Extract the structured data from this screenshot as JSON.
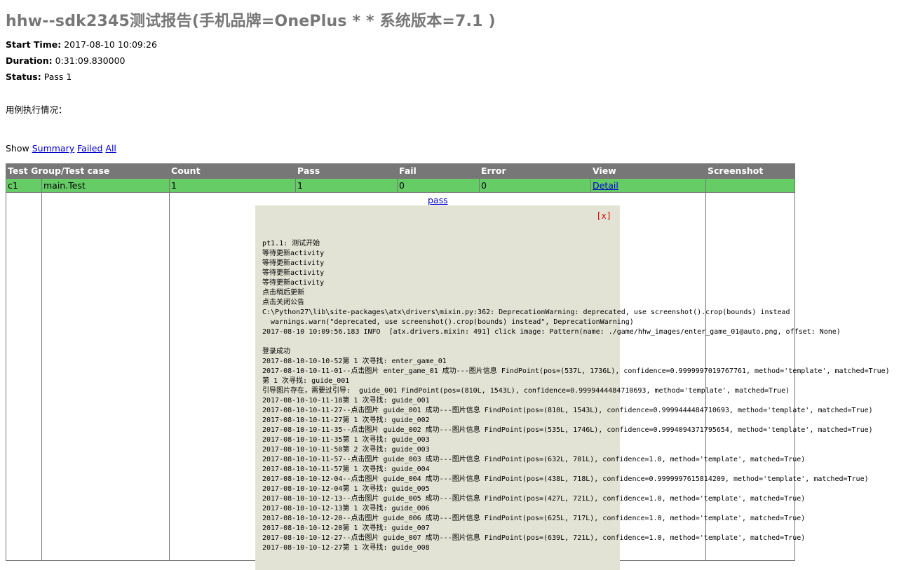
{
  "header": {
    "title": "hhw--sdk2345测试报告(手机品牌=OnePlus * * 系统版本=7.1 )",
    "start_label": "Start Time:",
    "start_value": "2017-08-10 10:09:26",
    "duration_label": "Duration:",
    "duration_value": "0:31:09.830000",
    "status_label": "Status:",
    "status_value": "Pass 1"
  },
  "usage_text": "用例执行情况：",
  "filter": {
    "show_label": "Show",
    "summary": "Summary",
    "failed": "Failed",
    "all": "All"
  },
  "table": {
    "headers": [
      "Test Group/Test case",
      "Count",
      "Pass",
      "Fail",
      "Error",
      "View",
      "Screenshot"
    ],
    "row": {
      "group": "c1",
      "case": "main.Test",
      "count": "1",
      "pass": "1",
      "fail": "0",
      "error": "0",
      "view": "Detail",
      "screenshot": ""
    }
  },
  "detail": {
    "pass_link": "pass",
    "close": "[x]",
    "log_lines": [
      "pt1.1: 测试开始",
      "等待更新activity",
      "等待更新activity",
      "等待更新activity",
      "等待更新activity",
      "点击稍后更新",
      "点击关闭公告",
      "C:\\Python27\\lib\\site-packages\\atx\\drivers\\mixin.py:362: DeprecationWarning: deprecated, use screenshot().crop(bounds) instead",
      "  warnings.warn(\"deprecated, use screenshot().crop(bounds) instead\", DeprecationWarning)",
      "2017-08-10 10:09:56.183 INFO  [atx.drivers.mixin: 491] click image: Pattern(name: ./game/hhw_images/enter_game_01@auto.png, offset: None)",
      "",
      "登录成功",
      "2017-08-10-10-10-52第 1 次寻找: enter_game_01",
      "2017-08-10-10-11-01--点击图片 enter_game_01 成功---图片信息 FindPoint(pos=(537L, 1736L), confidence=0.9999997019767761, method='template', matched=True)",
      "第 1 次寻找: guide_001",
      "引导图片存在，需要过引导:  guide_001 FindPoint(pos=(810L, 1543L), confidence=0.9999444484710693, method='template', matched=True)",
      "2017-08-10-10-11-18第 1 次寻找: guide_001",
      "2017-08-10-10-11-27--点击图片 guide_001 成功---图片信息 FindPoint(pos=(810L, 1543L), confidence=0.9999444484710693, method='template', matched=True)",
      "2017-08-10-10-11-27第 1 次寻找: guide_002",
      "2017-08-10-10-11-35--点击图片 guide_002 成功---图片信息 FindPoint(pos=(535L, 1746L), confidence=0.9994094371795654, method='template', matched=True)",
      "2017-08-10-10-11-35第 1 次寻找: guide_003",
      "2017-08-10-10-11-50第 2 次寻找: guide_003",
      "2017-08-10-10-11-57--点击图片 guide_003 成功---图片信息 FindPoint(pos=(632L, 701L), confidence=1.0, method='template', matched=True)",
      "2017-08-10-10-11-57第 1 次寻找: guide_004",
      "2017-08-10-10-12-04--点击图片 guide_004 成功---图片信息 FindPoint(pos=(438L, 718L), confidence=0.9999997615814209, method='template', matched=True)",
      "2017-08-10-10-12-04第 1 次寻找: guide_005",
      "2017-08-10-10-12-13--点击图片 guide_005 成功---图片信息 FindPoint(pos=(427L, 721L), confidence=1.0, method='template', matched=True)",
      "2017-08-10-10-12-13第 1 次寻找: guide_006",
      "2017-08-10-10-12-20--点击图片 guide_006 成功---图片信息 FindPoint(pos=(625L, 717L), confidence=1.0, method='template', matched=True)",
      "2017-08-10-10-12-20第 1 次寻找: guide_007",
      "2017-08-10-10-12-27--点击图片 guide_007 成功---图片信息 FindPoint(pos=(639L, 721L), confidence=1.0, method='template', matched=True)",
      "2017-08-10-10-12-27第 1 次寻找: guide_008"
    ]
  }
}
